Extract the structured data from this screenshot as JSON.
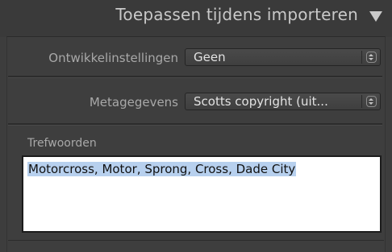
{
  "header": {
    "title": "Toepassen tijdens importeren"
  },
  "develop_settings": {
    "label": "Ontwikkelinstellingen",
    "value": "Geen"
  },
  "metadata": {
    "label": "Metagegevens",
    "value": "Scotts copyright (uit..."
  },
  "keywords": {
    "label": "Trefwoorden",
    "value": "Motorcross, Motor, Sprong, Cross, Dade City"
  },
  "icons": {
    "collapse": "triangle-down-icon",
    "select_arrows": "updown-arrows-icon"
  }
}
